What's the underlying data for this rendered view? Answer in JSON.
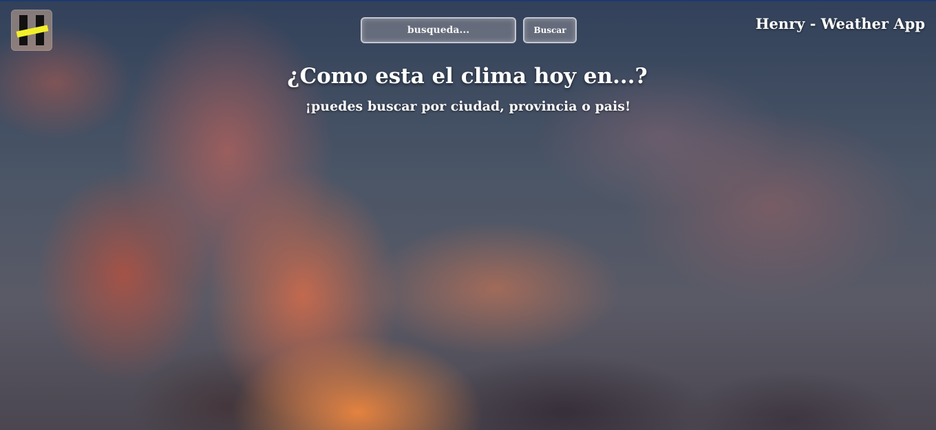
{
  "header": {
    "logo_icon": "henry-logo-icon",
    "app_title": "Henry - Weather App"
  },
  "search": {
    "placeholder": "busqueda...",
    "value": "",
    "button_label": "Buscar"
  },
  "hero": {
    "title": "¿Como esta el clima hoy en...?",
    "subtitle": "¡puedes buscar por ciudad, provincia o pais!"
  },
  "colors": {
    "logo_stripe": "#f2ef2a",
    "top_border": "#1e3a6e"
  }
}
